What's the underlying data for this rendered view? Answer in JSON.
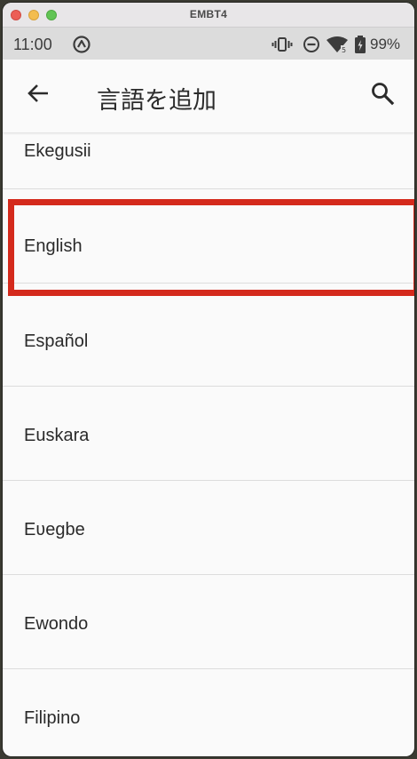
{
  "window": {
    "title": "EMBT4"
  },
  "status_bar": {
    "time": "11:00",
    "battery": "99%",
    "icons": [
      "assistant-icon",
      "vibrate-icon",
      "dnd-icon",
      "wifi-icon",
      "battery-icon"
    ]
  },
  "app_bar": {
    "title": "言語を追加",
    "back_icon": "arrow-left-icon",
    "search_icon": "search-icon"
  },
  "languages": [
    "Ekegusii",
    "English",
    "Español",
    "Euskara",
    "Eʋegbe",
    "Ewondo",
    "Filipino"
  ],
  "highlight": {
    "item": "English",
    "color": "#d42a1c"
  },
  "colors": {
    "background": "#fafafa",
    "status_bar": "#dcdcdc",
    "divider": "#dcdcdc",
    "text": "#2a2a2a"
  }
}
